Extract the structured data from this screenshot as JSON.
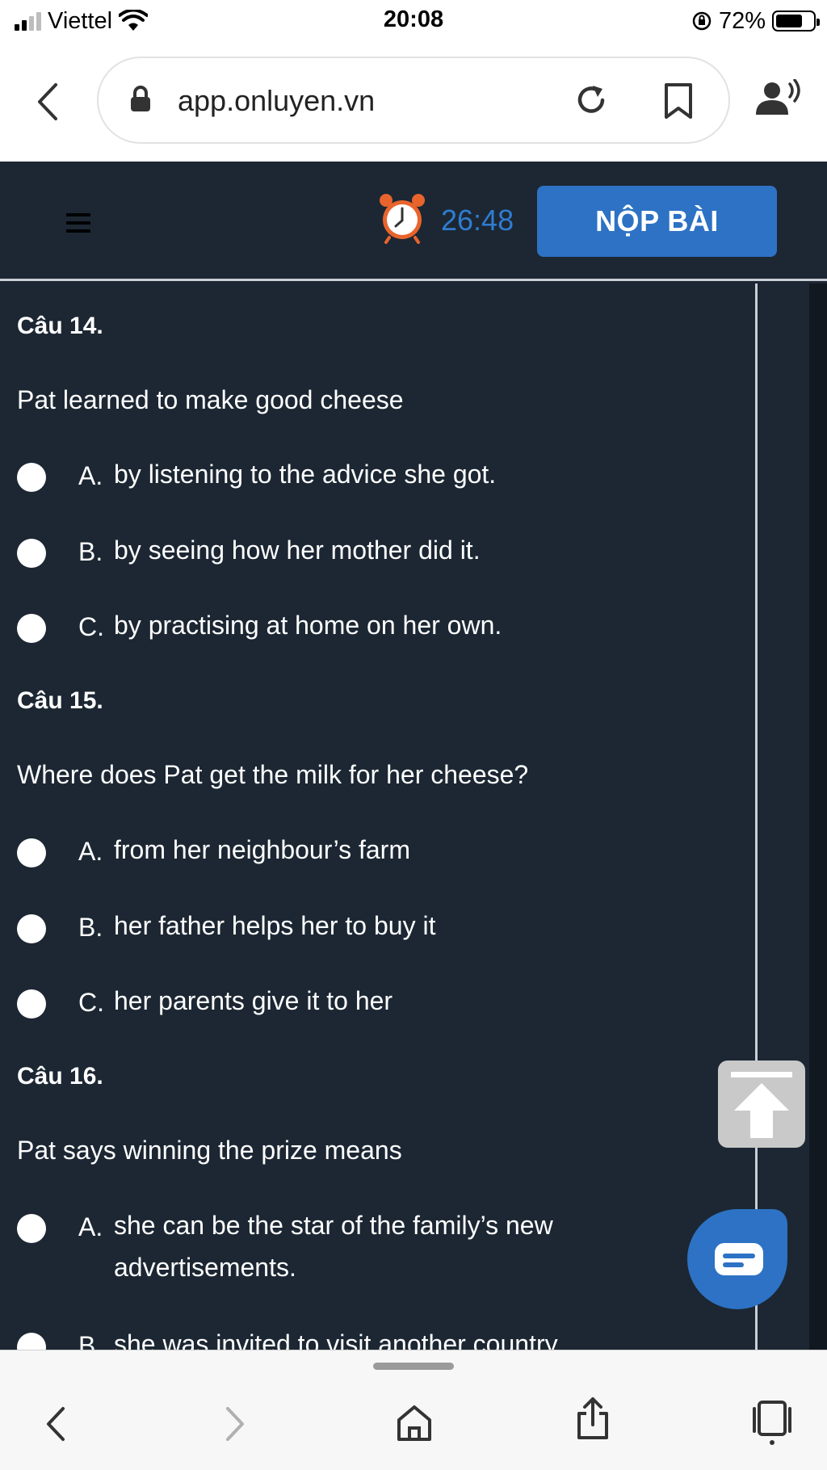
{
  "status_bar": {
    "carrier": "Viettel",
    "time": "20:08",
    "battery": "72%"
  },
  "browser": {
    "url": "app.onluyen.vn"
  },
  "app_header": {
    "timer": "26:48",
    "submit_label": "NỘP BÀI"
  },
  "questions": [
    {
      "label": "Câu 14.",
      "text": "Pat learned to make good cheese",
      "options": [
        {
          "letter": "A.",
          "text": "by listening to the advice she got."
        },
        {
          "letter": "B.",
          "text": "by seeing how her mother did it."
        },
        {
          "letter": "C.",
          "text": "by practising at home on her own."
        }
      ]
    },
    {
      "label": "Câu 15.",
      "text": "Where does Pat get the milk for her cheese?",
      "options": [
        {
          "letter": "A.",
          "text": "from her neighbour’s farm"
        },
        {
          "letter": "B.",
          "text": "her father helps her to buy it"
        },
        {
          "letter": "C.",
          "text": "her parents give it to her"
        }
      ]
    },
    {
      "label": "Câu 16.",
      "text": "Pat says winning the prize means",
      "options": [
        {
          "letter": "A.",
          "text": "she can be the star of the family’s new advertisements."
        },
        {
          "letter": "B.",
          "text": "she was invited to visit another country"
        }
      ]
    }
  ],
  "colors": {
    "app_background": "#1c2733",
    "accent_blue": "#2d72c4",
    "timer_blue": "#2f7cd0",
    "clock_orange": "#e8642c"
  },
  "icons": {
    "status": [
      "signal-icon",
      "wifi-icon",
      "orientation-lock-icon",
      "battery-icon"
    ],
    "browser": [
      "back-icon",
      "lock-icon",
      "reload-icon",
      "bookmark-icon",
      "listen-icon"
    ],
    "app": [
      "menu-icon",
      "alarm-clock-icon",
      "scroll-top-icon",
      "chat-icon"
    ],
    "bottom_nav": [
      "back-icon",
      "forward-icon",
      "home-icon",
      "share-icon",
      "tabs-icon"
    ]
  }
}
